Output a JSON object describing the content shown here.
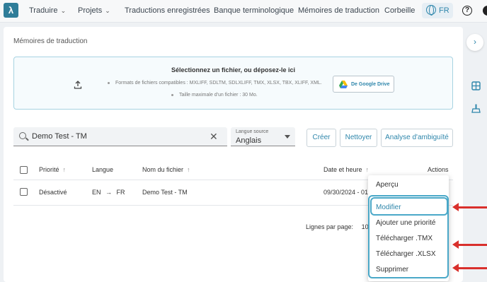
{
  "nav": {
    "logo": "λ",
    "items": [
      {
        "label": "Traduire",
        "has_chevron": true
      },
      {
        "label": "Projets",
        "has_chevron": true
      },
      {
        "label": "Traductions enregistrées",
        "has_chevron": false
      },
      {
        "label": "Banque terminologique",
        "has_chevron": false
      },
      {
        "label": "Mémoires de traduction",
        "has_chevron": false
      },
      {
        "label": "Corbeille",
        "has_chevron": false
      }
    ],
    "language": "FR",
    "help": "?"
  },
  "page": {
    "title": "Mémoires de traduction"
  },
  "upload": {
    "title": "Sélectionnez un fichier, ou déposez-le ici",
    "formats": "Formats de fichiers compatibles : MXLIFF, SDLTM, SDLXLIFF, TMX, XLSX, TBX, XLIFF, XML.",
    "max_size": "Taille maximale d'un fichier : 30 Mo.",
    "gdrive_label": "De Google Drive"
  },
  "filters": {
    "search_value": "Demo Test - TM",
    "source_lang_label": "Langue source",
    "source_lang_value": "Anglais"
  },
  "actions": {
    "create": "Créer",
    "clean": "Nettoyer",
    "ambiguity": "Analyse d'ambiguïté"
  },
  "table": {
    "headers": {
      "priority": "Priorité",
      "language": "Langue",
      "filename": "Nom du fichier",
      "datetime": "Date et heure",
      "actions": "Actions"
    },
    "rows": [
      {
        "priority": "Désactivé",
        "source_lang": "EN",
        "target_lang": "FR",
        "filename": "Demo Test - TM",
        "datetime": "09/30/2024 - 01:"
      }
    ]
  },
  "pagination": {
    "rows_per_page_label": "Lignes par page:",
    "rows_per_page": "10"
  },
  "menu": {
    "items": [
      "Aperçu",
      "Modifier",
      "Ajouter une priorité",
      "Télécharger .TMX",
      "Télécharger .XLSX",
      "Supprimer"
    ],
    "active_item": "Modifier"
  },
  "colors": {
    "accent": "#2e86ab",
    "highlight": "#4aa8c8",
    "annotation": "#d9302c"
  }
}
